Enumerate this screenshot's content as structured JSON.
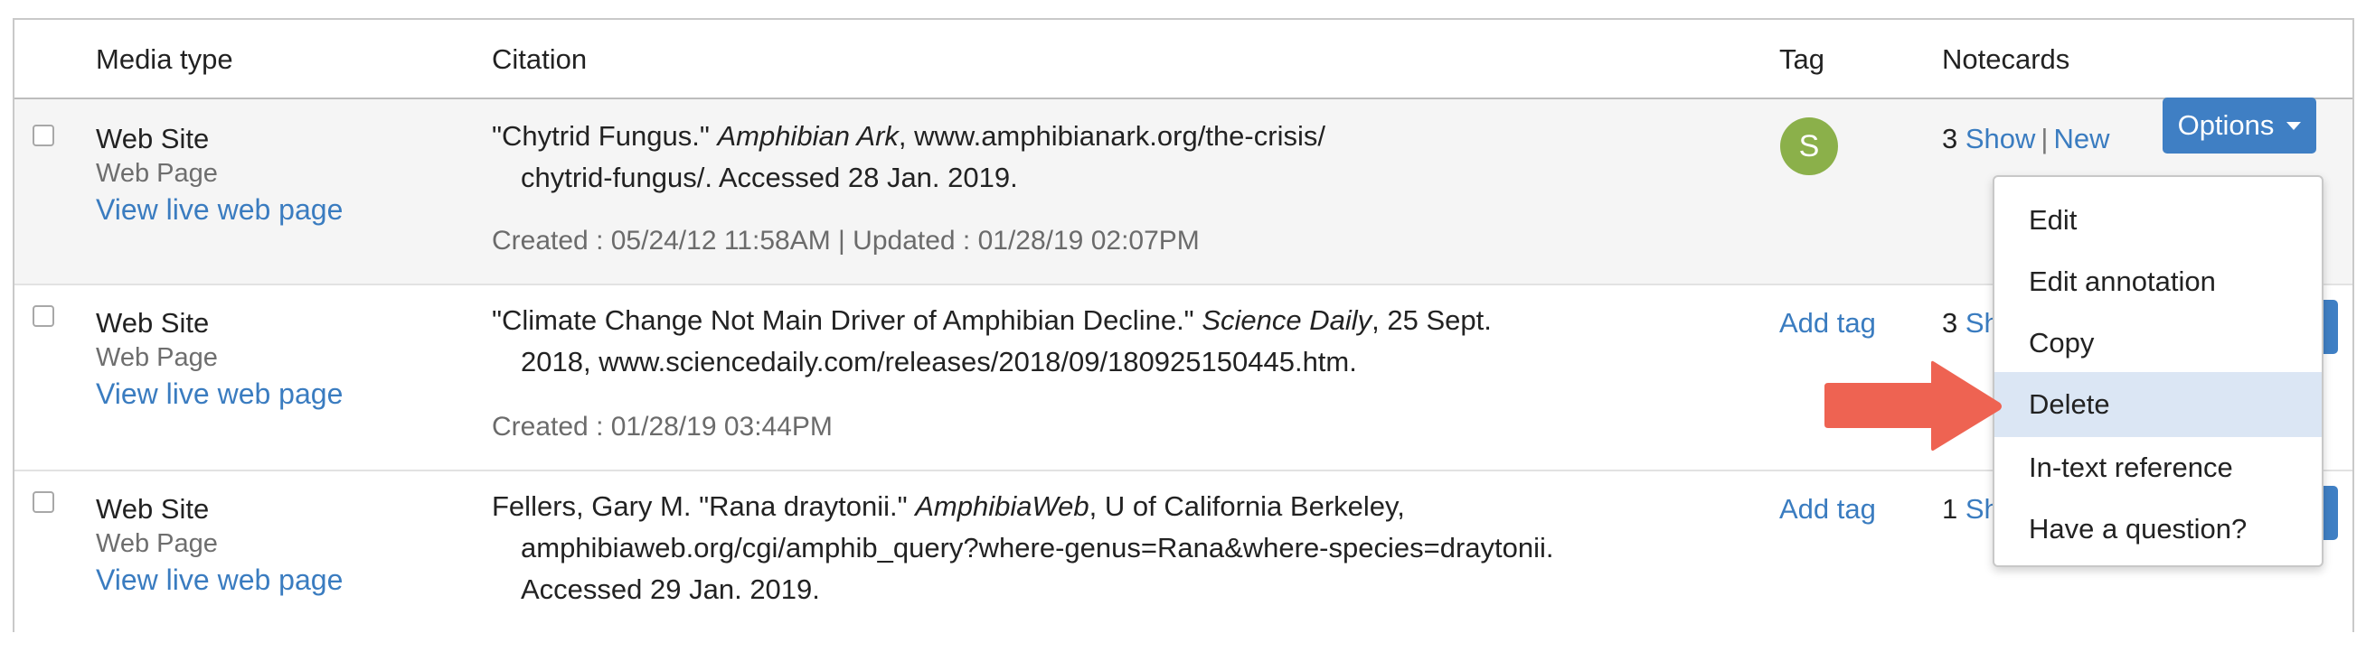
{
  "table": {
    "headers": {
      "media_type": "Media type",
      "citation": "Citation",
      "tag": "Tag",
      "notecards": "Notecards"
    },
    "rows": [
      {
        "media_type": "Web Site",
        "subtype": "Web Page",
        "live_link": "View live web page",
        "citation_prefix": "\"Chytrid Fungus.\"",
        "citation_italic": "Amphibian Ark",
        "citation_rest": ", www.amphibianark.org/the-crisis/",
        "citation_line2": "chytrid-fungus/. Accessed 28 Jan. 2019.",
        "dates": "Created : 05/24/12 11:58AM | Updated : 01/28/19 02:07PM",
        "tag_initial": "S",
        "notecard_count": "3",
        "show_label": "Show",
        "new_label": "New"
      },
      {
        "media_type": "Web Site",
        "subtype": "Web Page",
        "live_link": "View live web page",
        "citation_prefix": "\"Climate Change Not Main Driver of Amphibian Decline.\"",
        "citation_italic": "Science Daily",
        "citation_rest": ", 25 Sept.",
        "citation_line2": "2018, www.sciencedaily.com/releases/2018/09/180925150445.htm.",
        "dates": "Created : 01/28/19 03:44PM",
        "add_tag": "Add tag",
        "notecard_count": "3",
        "show_partial": "Sh"
      },
      {
        "media_type": "Web Site",
        "subtype": "Web Page",
        "live_link": "View live web page",
        "citation_prefix": "Fellers, Gary M. \"Rana draytonii.\"",
        "citation_italic": "AmphibiaWeb",
        "citation_rest": ", U of California Berkeley,",
        "citation_line2": "amphibiaweb.org/cgi/amphib_query?where-genus=Rana&where-species=draytonii.",
        "citation_line3": "Accessed 29 Jan. 2019.",
        "add_tag": "Add tag",
        "notecard_count": "1",
        "show_partial": "Sh"
      }
    ]
  },
  "options_button": {
    "label": "Options"
  },
  "dropdown": {
    "items": [
      "Edit",
      "Edit annotation",
      "Copy",
      "Delete",
      "In-text reference",
      "Have a question?"
    ],
    "highlighted": "Delete"
  },
  "colors": {
    "link": "#3a7cc0",
    "button": "#3f7fc4",
    "avatar": "#8bb04a",
    "highlight": "#dbe6f4",
    "arrow": "#ee6352"
  }
}
